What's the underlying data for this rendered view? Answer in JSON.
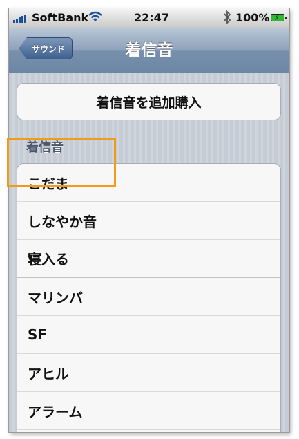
{
  "status_bar": {
    "carrier": "SoftBank",
    "time": "22:47",
    "battery": "100%"
  },
  "nav": {
    "back_label": "サウンド",
    "title": "着信音"
  },
  "buy_button_label": "着信音を追加購入",
  "section_title": "着信音",
  "ringtones": [
    "こだま",
    "しなやか音",
    "寝入る",
    "マリンバ",
    "SF",
    "アヒル",
    "アラーム"
  ],
  "colors": {
    "highlight": "#f39a18",
    "navbar": "#8da1b9",
    "battery": "#2fb832"
  },
  "icons": [
    "signal-icon",
    "wifi-icon",
    "bluetooth-icon",
    "battery-icon"
  ]
}
